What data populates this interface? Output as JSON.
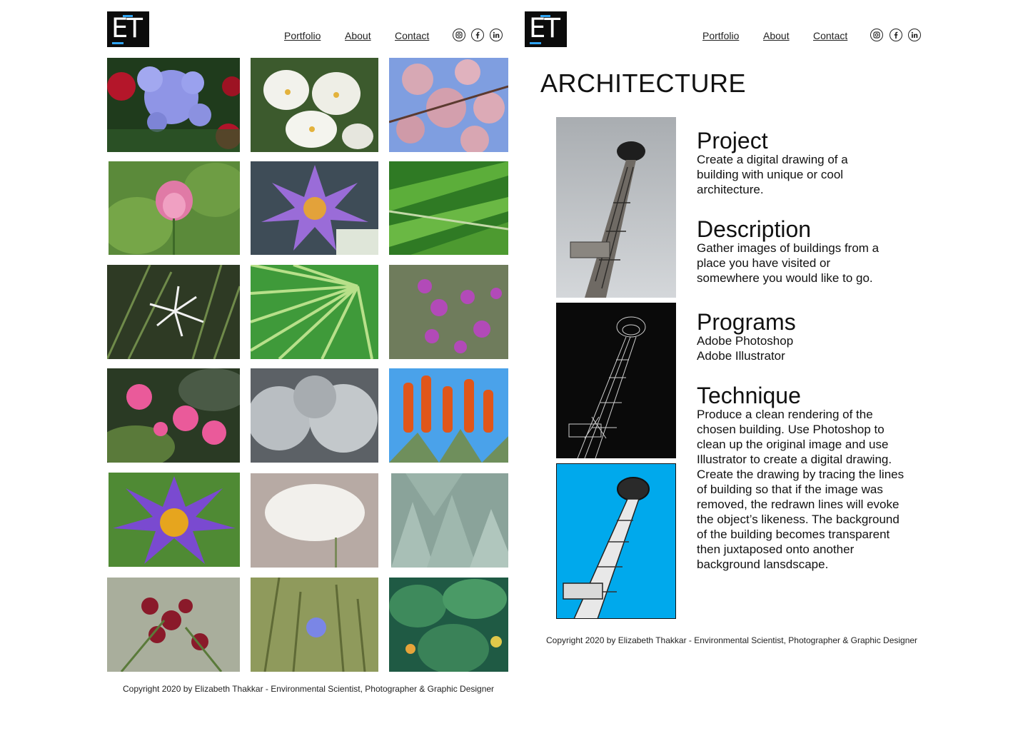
{
  "brand": {
    "logo_text": "ET",
    "accent": "#2ea3f2"
  },
  "nav": {
    "portfolio": "Portfolio",
    "about": "About",
    "contact": "Contact"
  },
  "social": [
    "instagram-icon",
    "facebook-icon",
    "linkedin-icon"
  ],
  "gallery": {
    "photos": [
      "blue-plumbago-flowers",
      "white-lilies",
      "pink-cherry-blossoms",
      "pink-lotus-flower",
      "purple-water-lily",
      "palm-frond",
      "white-spider-lily",
      "fan-palm-leaf",
      "purple-loosestrife",
      "pink-water-lilies",
      "fuzzy-cactus",
      "orange-aloe-flowers",
      "purple-water-lily-closeup",
      "white-queen-annes-lace",
      "agave-leaves",
      "red-geranium",
      "blue-chicory-flower",
      "calathea-leaves"
    ]
  },
  "footer": {
    "copyright": "Copyright 2020 by Elizabeth Thakkar - Environmental Scientist, Photographer & Graphic Designer"
  },
  "architecture": {
    "title": "ARCHITECTURE",
    "images": [
      "space-needle-photo",
      "space-needle-line-drawing",
      "space-needle-blue-rendering"
    ],
    "sections": [
      {
        "heading": "Project",
        "body": "Create a digital drawing of a building with unique or cool architecture."
      },
      {
        "heading": "Description",
        "body": "Gather images of buildings from a place you have visited or somewhere you would like to go."
      },
      {
        "heading": "Programs",
        "lines": [
          "Adobe Photoshop",
          "Adobe Illustrator"
        ]
      },
      {
        "heading": "Technique",
        "body": "Produce a clean rendering of the chosen building. Use Photoshop to clean up the original image and use Illustrator to create a digital drawing. Create the drawing by tracing the lines of building so that if the image was removed, the redrawn lines will evoke the object’s likeness. The background of the building becomes transparent then juxtaposed onto another background lansdscape."
      }
    ]
  }
}
